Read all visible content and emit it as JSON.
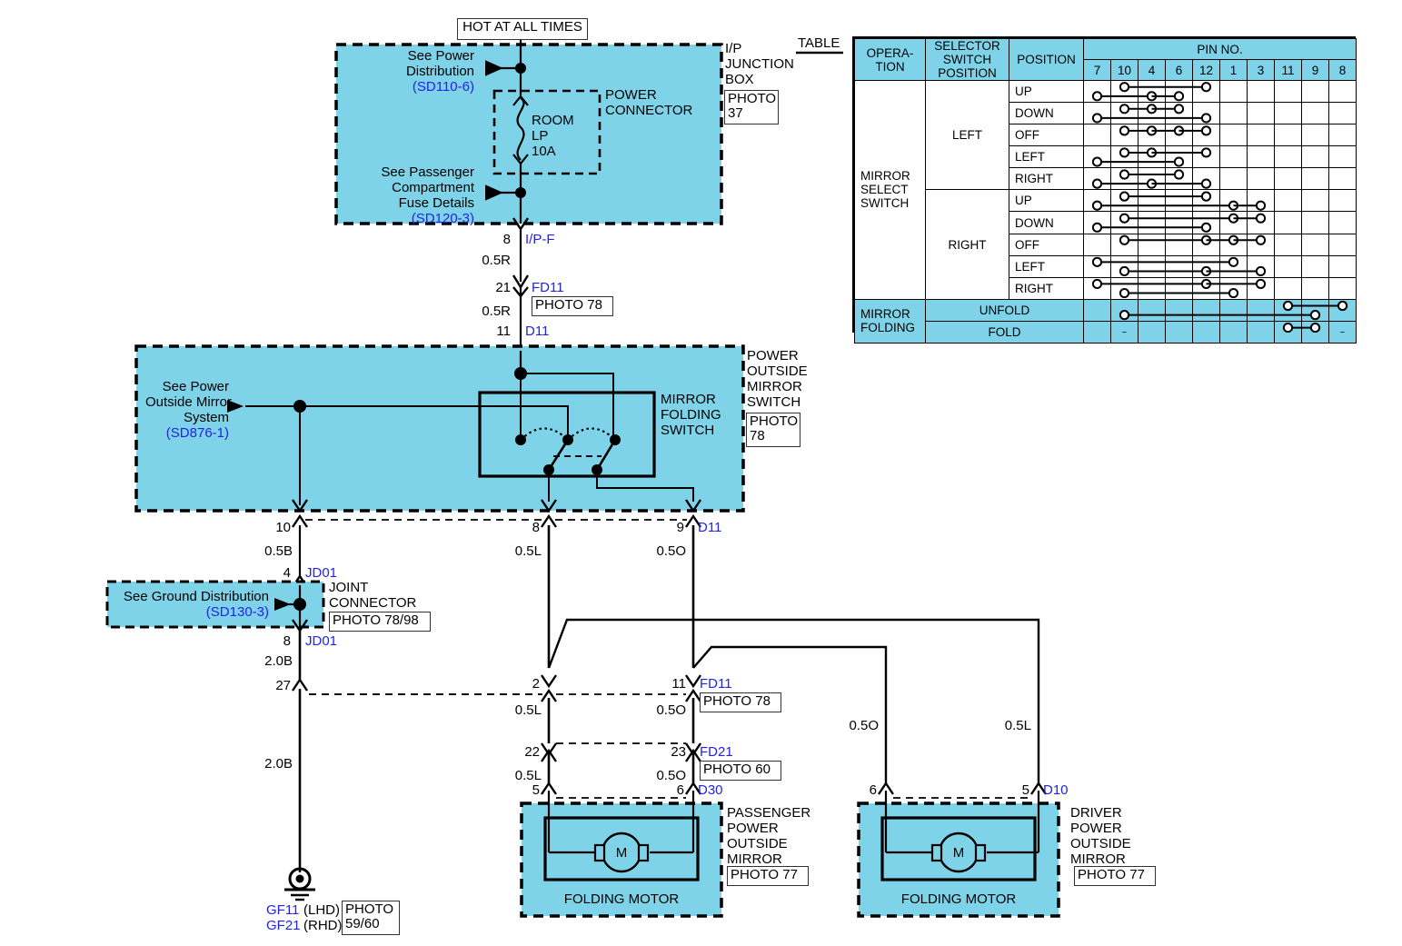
{
  "diagram": {
    "top_label": "HOT AT ALL TIMES",
    "table_caption": "TABLE"
  },
  "ip_junction_box": {
    "title_lines": [
      "I/P",
      "JUNCTION",
      "BOX"
    ],
    "photo": "PHOTO\n37",
    "photo_line1": "PHOTO",
    "photo_line2": "37",
    "power_connector_label_1": "POWER",
    "power_connector_label_2": "CONNECTOR",
    "see_power_distribution": [
      "See Power",
      "Distribution"
    ],
    "see_power_distribution_ref": "(SD110-6)",
    "see_passenger_fuse": [
      "See Passenger",
      "Compartment",
      "Fuse Details"
    ],
    "see_passenger_fuse_ref": "(SD120-3)",
    "fuse_name": "ROOM",
    "fuse_name2": "LP",
    "fuse_rating": "10A"
  },
  "wires_top": {
    "pin_ipf": "8",
    "conn_ipf": "I/P-F",
    "gauge_1": "0.5R",
    "pin_fd11": "21",
    "conn_fd11": "FD11",
    "photo_fd11": "PHOTO 78",
    "gauge_2": "0.5R",
    "pin_d11": "11",
    "conn_d11": "D11"
  },
  "power_outside_mirror_switch": {
    "title_lines": [
      "POWER",
      "OUTSIDE",
      "MIRROR",
      "SWITCH"
    ],
    "photo_line1": "PHOTO",
    "photo_line2": "78",
    "switch_label_lines": [
      "MIRROR",
      "FOLDING",
      "SWITCH"
    ],
    "see_power_outside_mirror": [
      "See Power",
      "Outside Mirror",
      "System"
    ],
    "see_power_outside_mirror_ref": "(SD876-1)",
    "out_pin_10": "10",
    "out_pin_8": "8",
    "out_pin_9": "9",
    "out_conn": "D11"
  },
  "ground_branch": {
    "gauge_05b": "0.5B",
    "pin_4": "4",
    "conn_jd01_top": "JD01",
    "joint_connector_lines": [
      "JOINT",
      "CONNECTOR"
    ],
    "joint_photo": "PHOTO 78/98",
    "see_ground_distribution": "See Ground Distribution",
    "see_ground_distribution_ref": "(SD130-3)",
    "pin_8": "8",
    "conn_jd01_bot": "JD01",
    "gauge_20b_1": "2.0B",
    "pin_27": "27",
    "gauge_20b_2": "2.0B",
    "ground_lhd": "GF11",
    "ground_lhd_suffix": "(LHD)",
    "ground_rhd": "GF21",
    "ground_rhd_suffix": "(RHD)",
    "ground_photo_line1": "PHOTO",
    "ground_photo_line2": "59/60"
  },
  "passenger_branch": {
    "gauge_05l_a": "0.5L",
    "gauge_05o_a": "0.5O",
    "pin_2": "2",
    "pin_11": "11",
    "conn_fd11": "FD11",
    "photo_fd11": "PHOTO 78",
    "gauge_05l_b": "0.5L",
    "gauge_05o_b": "0.5O",
    "pin_22": "22",
    "pin_23": "23",
    "conn_fd21": "FD21",
    "photo_fd21": "PHOTO 60",
    "gauge_05l_c": "0.5L",
    "gauge_05o_c": "0.5O",
    "pin_5": "5",
    "pin_6": "6",
    "conn_d30": "D30",
    "motor_title_lines": [
      "PASSENGER",
      "POWER",
      "OUTSIDE",
      "MIRROR"
    ],
    "motor_photo": "PHOTO 77",
    "motor_symbol": "M",
    "motor_caption": "FOLDING MOTOR"
  },
  "driver_branch": {
    "gauge_05o": "0.5O",
    "gauge_05l": "0.5L",
    "pin_6": "6",
    "pin_5": "5",
    "conn_d10": "D10",
    "motor_title_lines": [
      "DRIVER",
      "POWER",
      "OUTSIDE",
      "MIRROR"
    ],
    "motor_photo": "PHOTO 77",
    "motor_symbol": "M",
    "motor_caption": "FOLDING MOTOR"
  },
  "chart_data": {
    "type": "table",
    "title": "TABLE",
    "headers": {
      "operation": "OPERA-\nTION",
      "operation_line1": "OPERA-",
      "operation_line2": "TION",
      "selector_switch_position_line1": "SELECTOR",
      "selector_switch_position_line2": "SWITCH",
      "selector_switch_position_line3": "POSITION",
      "position": "POSITION",
      "pin_no": "PIN NO."
    },
    "pin_columns": [
      "7",
      "10",
      "4",
      "6",
      "12",
      "1",
      "3",
      "11",
      "9",
      "8"
    ],
    "groups": [
      {
        "operation": "MIRROR\nSELECT\nSWITCH",
        "operation_line1": "MIRROR",
        "operation_line2": "SELECT",
        "operation_line3": "SWITCH",
        "selector": "LEFT",
        "rows": [
          {
            "position": "UP",
            "links": [
              [
                "10",
                "12"
              ],
              [
                "7",
                "4"
              ],
              [
                "4",
                "6"
              ]
            ]
          },
          {
            "position": "DOWN",
            "links": [
              [
                "10",
                "4"
              ],
              [
                "4",
                "6"
              ],
              [
                "7",
                "12"
              ]
            ]
          },
          {
            "position": "OFF",
            "links": [
              [
                "10",
                "4"
              ],
              [
                "4",
                "6"
              ],
              [
                "6",
                "12"
              ]
            ]
          },
          {
            "position": "LEFT",
            "links": [
              [
                "10",
                "4"
              ],
              [
                "4",
                "12"
              ],
              [
                "7",
                "6"
              ]
            ]
          },
          {
            "position": "RIGHT",
            "links": [
              [
                "10",
                "6"
              ],
              [
                "7",
                "4"
              ],
              [
                "4",
                "12"
              ]
            ]
          }
        ]
      },
      {
        "operation": "",
        "selector": "RIGHT",
        "rows": [
          {
            "position": "UP",
            "links": [
              [
                "10",
                "12"
              ],
              [
                "7",
                "1"
              ],
              [
                "1",
                "3"
              ]
            ]
          },
          {
            "position": "DOWN",
            "links": [
              [
                "10",
                "1"
              ],
              [
                "1",
                "3"
              ],
              [
                "7",
                "12"
              ]
            ]
          },
          {
            "position": "OFF",
            "links": [
              [
                "10",
                "12"
              ],
              [
                "12",
                "1"
              ],
              [
                "1",
                "3"
              ]
            ]
          },
          {
            "position": "LEFT",
            "links": [
              [
                "7",
                "1"
              ],
              [
                "10",
                "12"
              ],
              [
                "12",
                "3"
              ]
            ]
          },
          {
            "position": "RIGHT",
            "links": [
              [
                "7",
                "12"
              ],
              [
                "12",
                "3"
              ],
              [
                "10",
                "1"
              ]
            ]
          }
        ]
      }
    ],
    "folding": {
      "operation_line1": "MIRROR",
      "operation_line2": "FOLDING",
      "rows": [
        {
          "position": "UNFOLD",
          "links": [
            [
              "11",
              "8"
            ],
            [
              "10",
              "9"
            ]
          ]
        },
        {
          "position": "FOLD",
          "links": [
            [
              "11",
              "9"
            ],
            [
              "10",
              "8"
            ]
          ]
        }
      ]
    }
  },
  "colors": {
    "cyan": "#7FD3E8",
    "wire": "#000000",
    "ref_blue": "#2222EE"
  }
}
